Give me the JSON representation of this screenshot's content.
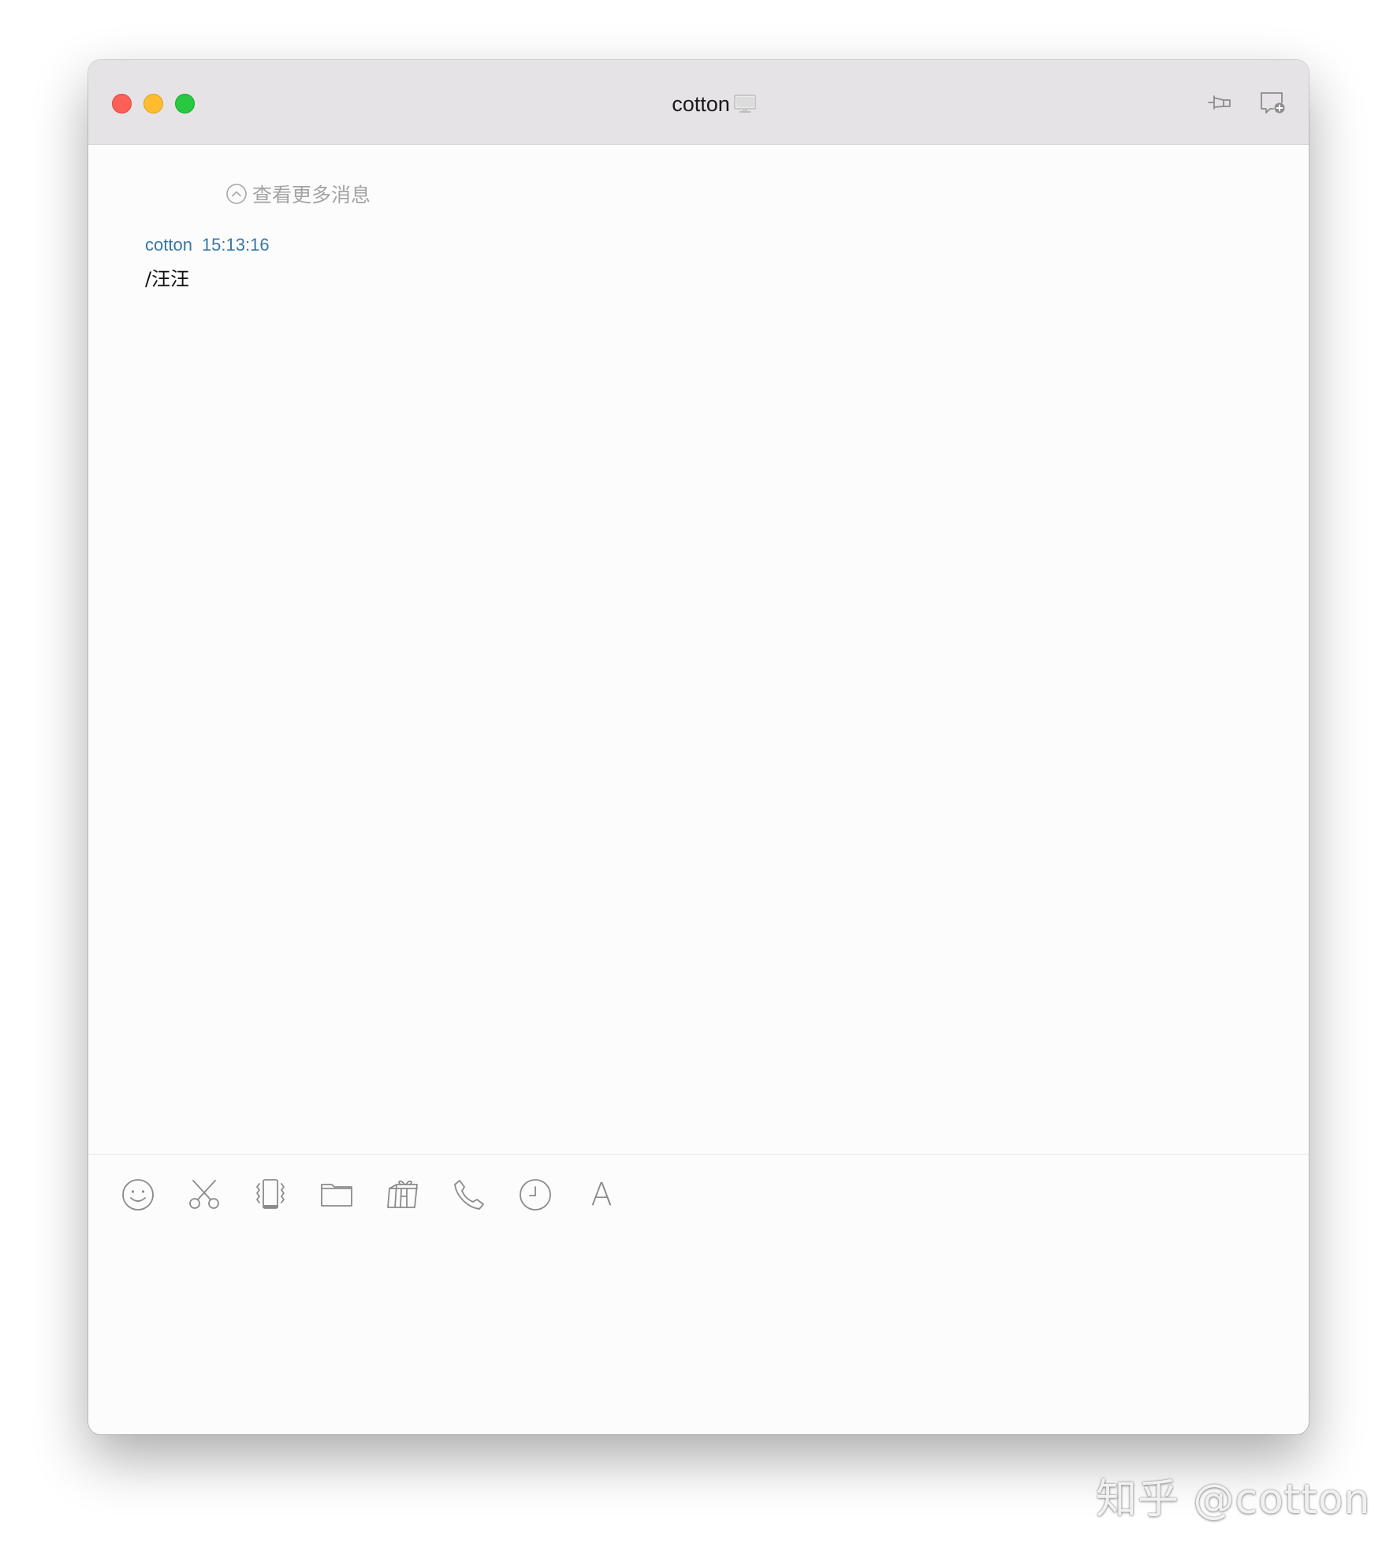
{
  "window": {
    "title": "cotton",
    "title_status_icon": "monitor-icon"
  },
  "titlebar_actions": [
    {
      "icon": "pin-icon"
    },
    {
      "icon": "add-chat-icon"
    }
  ],
  "chat": {
    "load_more_label": "查看更多消息",
    "messages": [
      {
        "sender": "cotton",
        "time": "15:13:16",
        "text": "/汪汪"
      }
    ]
  },
  "toolbar": {
    "items": [
      {
        "icon": "emoji-icon"
      },
      {
        "icon": "scissors-icon"
      },
      {
        "icon": "vibrate-icon"
      },
      {
        "icon": "folder-icon"
      },
      {
        "icon": "gift-icon"
      },
      {
        "icon": "phone-icon"
      },
      {
        "icon": "clock-icon"
      },
      {
        "icon": "font-icon",
        "label": "A"
      }
    ]
  },
  "input": {
    "value": ""
  },
  "watermark": "知乎 @cotton",
  "colors": {
    "titlebar_bg": "#e5e3e5",
    "sender_color": "#3678a8",
    "close": "#fe5f57",
    "minimize": "#febc2e",
    "maximize": "#28c840"
  }
}
